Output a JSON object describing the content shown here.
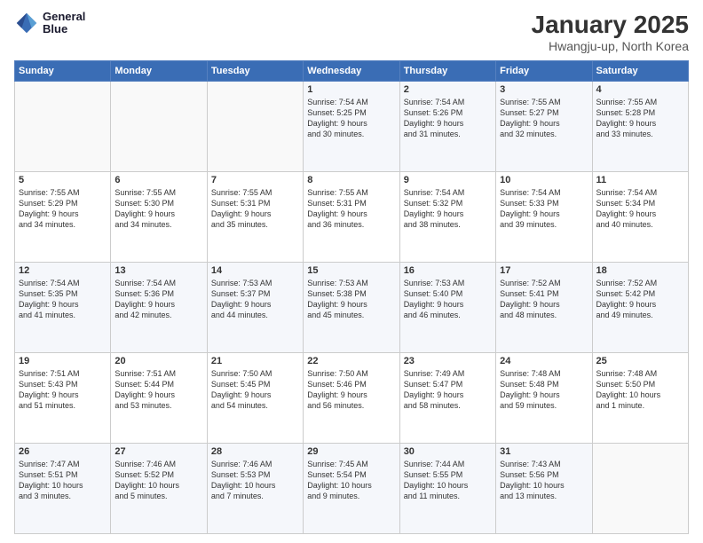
{
  "header": {
    "logo_line1": "General",
    "logo_line2": "Blue",
    "title": "January 2025",
    "subtitle": "Hwangju-up, North Korea"
  },
  "days_of_week": [
    "Sunday",
    "Monday",
    "Tuesday",
    "Wednesday",
    "Thursday",
    "Friday",
    "Saturday"
  ],
  "weeks": [
    [
      {
        "day": "",
        "info": ""
      },
      {
        "day": "",
        "info": ""
      },
      {
        "day": "",
        "info": ""
      },
      {
        "day": "1",
        "info": "Sunrise: 7:54 AM\nSunset: 5:25 PM\nDaylight: 9 hours\nand 30 minutes."
      },
      {
        "day": "2",
        "info": "Sunrise: 7:54 AM\nSunset: 5:26 PM\nDaylight: 9 hours\nand 31 minutes."
      },
      {
        "day": "3",
        "info": "Sunrise: 7:55 AM\nSunset: 5:27 PM\nDaylight: 9 hours\nand 32 minutes."
      },
      {
        "day": "4",
        "info": "Sunrise: 7:55 AM\nSunset: 5:28 PM\nDaylight: 9 hours\nand 33 minutes."
      }
    ],
    [
      {
        "day": "5",
        "info": "Sunrise: 7:55 AM\nSunset: 5:29 PM\nDaylight: 9 hours\nand 34 minutes."
      },
      {
        "day": "6",
        "info": "Sunrise: 7:55 AM\nSunset: 5:30 PM\nDaylight: 9 hours\nand 34 minutes."
      },
      {
        "day": "7",
        "info": "Sunrise: 7:55 AM\nSunset: 5:31 PM\nDaylight: 9 hours\nand 35 minutes."
      },
      {
        "day": "8",
        "info": "Sunrise: 7:55 AM\nSunset: 5:31 PM\nDaylight: 9 hours\nand 36 minutes."
      },
      {
        "day": "9",
        "info": "Sunrise: 7:54 AM\nSunset: 5:32 PM\nDaylight: 9 hours\nand 38 minutes."
      },
      {
        "day": "10",
        "info": "Sunrise: 7:54 AM\nSunset: 5:33 PM\nDaylight: 9 hours\nand 39 minutes."
      },
      {
        "day": "11",
        "info": "Sunrise: 7:54 AM\nSunset: 5:34 PM\nDaylight: 9 hours\nand 40 minutes."
      }
    ],
    [
      {
        "day": "12",
        "info": "Sunrise: 7:54 AM\nSunset: 5:35 PM\nDaylight: 9 hours\nand 41 minutes."
      },
      {
        "day": "13",
        "info": "Sunrise: 7:54 AM\nSunset: 5:36 PM\nDaylight: 9 hours\nand 42 minutes."
      },
      {
        "day": "14",
        "info": "Sunrise: 7:53 AM\nSunset: 5:37 PM\nDaylight: 9 hours\nand 44 minutes."
      },
      {
        "day": "15",
        "info": "Sunrise: 7:53 AM\nSunset: 5:38 PM\nDaylight: 9 hours\nand 45 minutes."
      },
      {
        "day": "16",
        "info": "Sunrise: 7:53 AM\nSunset: 5:40 PM\nDaylight: 9 hours\nand 46 minutes."
      },
      {
        "day": "17",
        "info": "Sunrise: 7:52 AM\nSunset: 5:41 PM\nDaylight: 9 hours\nand 48 minutes."
      },
      {
        "day": "18",
        "info": "Sunrise: 7:52 AM\nSunset: 5:42 PM\nDaylight: 9 hours\nand 49 minutes."
      }
    ],
    [
      {
        "day": "19",
        "info": "Sunrise: 7:51 AM\nSunset: 5:43 PM\nDaylight: 9 hours\nand 51 minutes."
      },
      {
        "day": "20",
        "info": "Sunrise: 7:51 AM\nSunset: 5:44 PM\nDaylight: 9 hours\nand 53 minutes."
      },
      {
        "day": "21",
        "info": "Sunrise: 7:50 AM\nSunset: 5:45 PM\nDaylight: 9 hours\nand 54 minutes."
      },
      {
        "day": "22",
        "info": "Sunrise: 7:50 AM\nSunset: 5:46 PM\nDaylight: 9 hours\nand 56 minutes."
      },
      {
        "day": "23",
        "info": "Sunrise: 7:49 AM\nSunset: 5:47 PM\nDaylight: 9 hours\nand 58 minutes."
      },
      {
        "day": "24",
        "info": "Sunrise: 7:48 AM\nSunset: 5:48 PM\nDaylight: 9 hours\nand 59 minutes."
      },
      {
        "day": "25",
        "info": "Sunrise: 7:48 AM\nSunset: 5:50 PM\nDaylight: 10 hours\nand 1 minute."
      }
    ],
    [
      {
        "day": "26",
        "info": "Sunrise: 7:47 AM\nSunset: 5:51 PM\nDaylight: 10 hours\nand 3 minutes."
      },
      {
        "day": "27",
        "info": "Sunrise: 7:46 AM\nSunset: 5:52 PM\nDaylight: 10 hours\nand 5 minutes."
      },
      {
        "day": "28",
        "info": "Sunrise: 7:46 AM\nSunset: 5:53 PM\nDaylight: 10 hours\nand 7 minutes."
      },
      {
        "day": "29",
        "info": "Sunrise: 7:45 AM\nSunset: 5:54 PM\nDaylight: 10 hours\nand 9 minutes."
      },
      {
        "day": "30",
        "info": "Sunrise: 7:44 AM\nSunset: 5:55 PM\nDaylight: 10 hours\nand 11 minutes."
      },
      {
        "day": "31",
        "info": "Sunrise: 7:43 AM\nSunset: 5:56 PM\nDaylight: 10 hours\nand 13 minutes."
      },
      {
        "day": "",
        "info": ""
      }
    ]
  ]
}
